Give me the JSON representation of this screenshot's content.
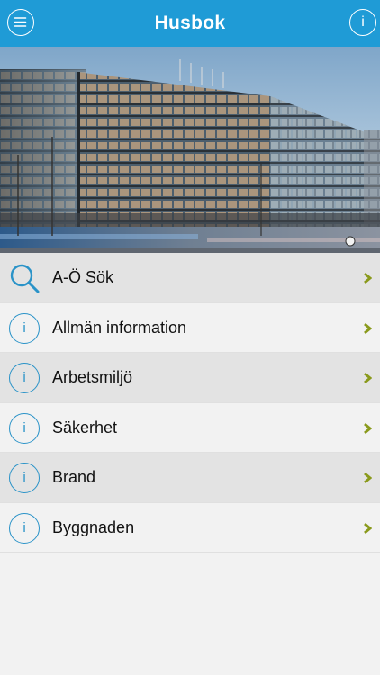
{
  "header": {
    "title": "Husbok",
    "menu_icon": "hamburger-menu-icon",
    "info_icon": "info-icon",
    "info_glyph": "i"
  },
  "hero": {
    "image": "office-building-photo"
  },
  "colors": {
    "header_bg": "#1f9bd6",
    "icon_blue": "#2a93c8",
    "chevron_green": "#8a9a1c",
    "row_dark": "#e3e3e3",
    "row_light": "#f2f2f2"
  },
  "menu": {
    "items": [
      {
        "label": "A-Ö Sök",
        "icon": "search-icon"
      },
      {
        "label": "Allmän information",
        "icon": "info-icon",
        "glyph": "i"
      },
      {
        "label": "Arbetsmiljö",
        "icon": "info-icon",
        "glyph": "i"
      },
      {
        "label": "Säkerhet",
        "icon": "info-icon",
        "glyph": "i"
      },
      {
        "label": "Brand",
        "icon": "info-icon",
        "glyph": "i"
      },
      {
        "label": "Byggnaden",
        "icon": "info-icon",
        "glyph": "i"
      }
    ]
  }
}
